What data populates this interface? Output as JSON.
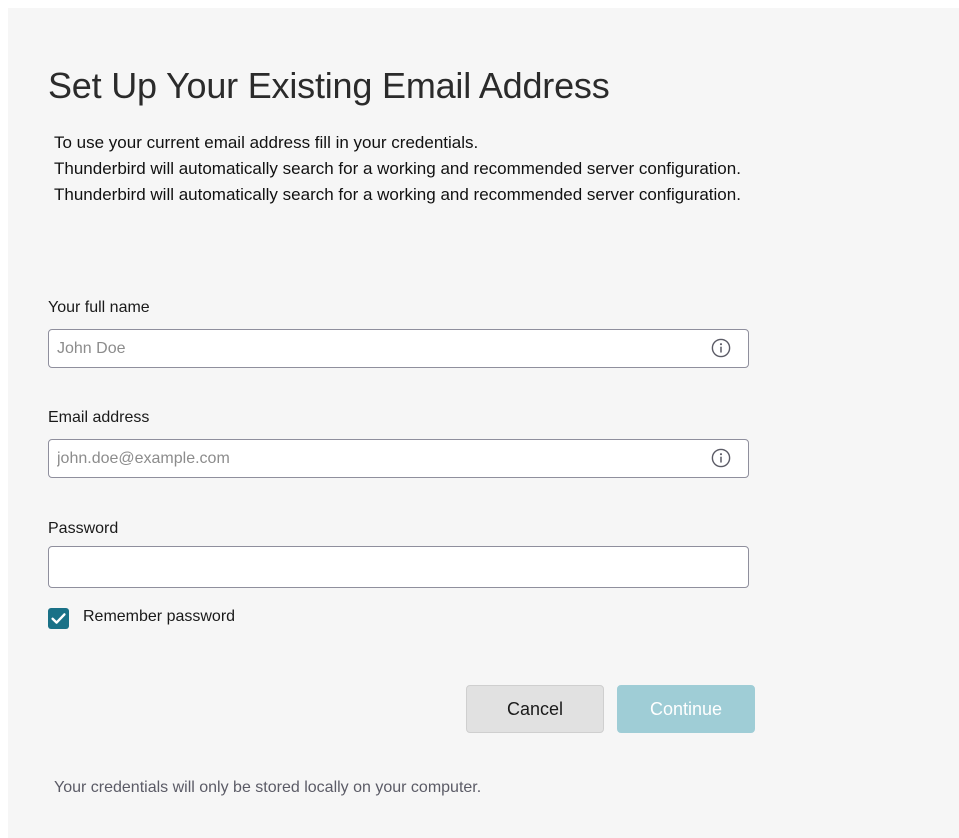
{
  "header": {
    "title": "Set Up Your Existing Email Address",
    "description": [
      "To use your current email address fill in your credentials.",
      "Thunderbird will automatically search for a working and recommended server configuration.",
      "Thunderbird will automatically search for a working and recommended server configuration."
    ]
  },
  "form": {
    "full_name": {
      "label": "Your full name",
      "placeholder": "John Doe",
      "value": "",
      "icon": "info-icon"
    },
    "email": {
      "label": "Email address",
      "placeholder": "john.doe@example.com",
      "value": "",
      "icon": "info-icon"
    },
    "password": {
      "label": "Password",
      "placeholder": "",
      "value": ""
    },
    "remember_password": {
      "label": "Remember password",
      "checked": true
    }
  },
  "actions": {
    "cancel_label": "Cancel",
    "continue_label": "Continue",
    "continue_enabled": false
  },
  "footer": {
    "note": "Your credentials will only be stored locally on your computer."
  },
  "colors": {
    "background": "#f6f6f6",
    "accent": "#1a7187",
    "continue_disabled": "#9fcdd6",
    "cancel_bg": "#e1e1e1",
    "input_border": "#8f8f9d"
  }
}
